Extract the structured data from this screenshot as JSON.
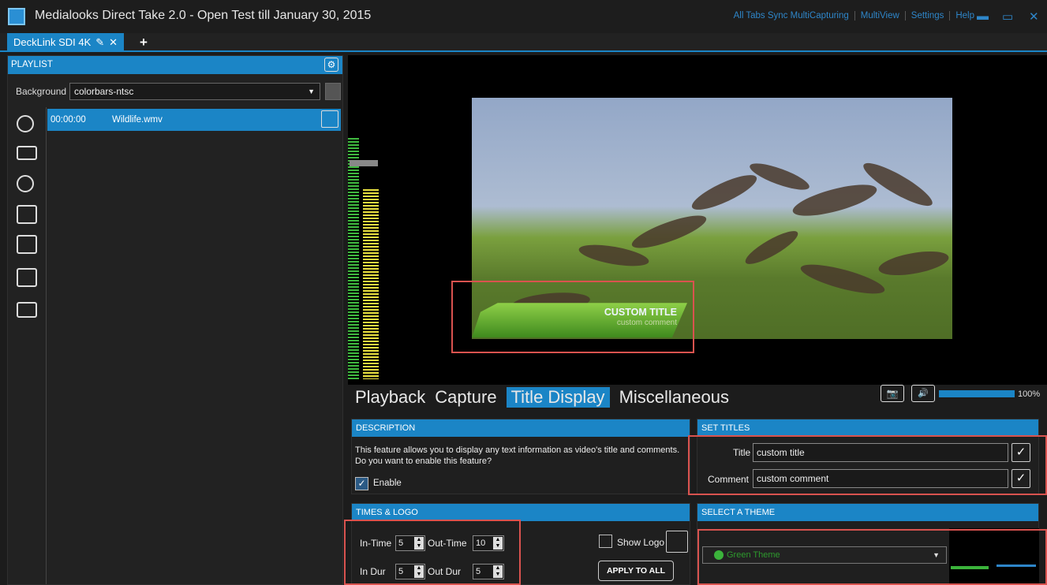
{
  "window": {
    "title": "Medialooks Direct Take 2.0 - Open Test till January 30, 2015",
    "menu": [
      "All Tabs Sync MultiCapturing",
      "MultiView",
      "Settings",
      "Help"
    ]
  },
  "device_tab": {
    "label": "DeckLink SDI 4K",
    "add": "+"
  },
  "playlist": {
    "header": "PLAYLIST",
    "background_label": "Background",
    "background_value": "colorbars-ntsc",
    "items": [
      {
        "time": "00:00:00",
        "name": "Wildlife.wmv"
      }
    ]
  },
  "preview": {
    "overlay_title": "CUSTOM TITLE",
    "overlay_comment": "custom comment"
  },
  "main_tabs": [
    "Playback",
    "Capture",
    "Title Display",
    "Miscellaneous"
  ],
  "active_tab": "Title Display",
  "volume": {
    "percent_label": "100%",
    "value": 1.0
  },
  "description": {
    "header": "DESCRIPTION",
    "text": "This feature allows you to display any text information as video's title and comments. Do you want to enable this feature?",
    "enable_label": "Enable",
    "enabled": true
  },
  "set_titles": {
    "header": "SET TITLES",
    "title_label": "Title",
    "title_value": "custom title",
    "comment_label": "Comment",
    "comment_value": "custom comment"
  },
  "times_logo": {
    "header": "TIMES & LOGO",
    "in_time_label": "In-Time",
    "in_time": "5",
    "out_time_label": "Out-Time",
    "out_time": "10",
    "in_dur_label": "In Dur",
    "in_dur": "5",
    "out_dur_label": "Out Dur",
    "out_dur": "5",
    "show_logo_label": "Show Logo",
    "apply_label": "APPLY TO ALL"
  },
  "theme": {
    "header": "SELECT A THEME",
    "selected": "Green Theme"
  },
  "colors": {
    "accent": "#1b85c6",
    "highlight_box": "#d9534f",
    "theme_green": "#3bb33b"
  }
}
